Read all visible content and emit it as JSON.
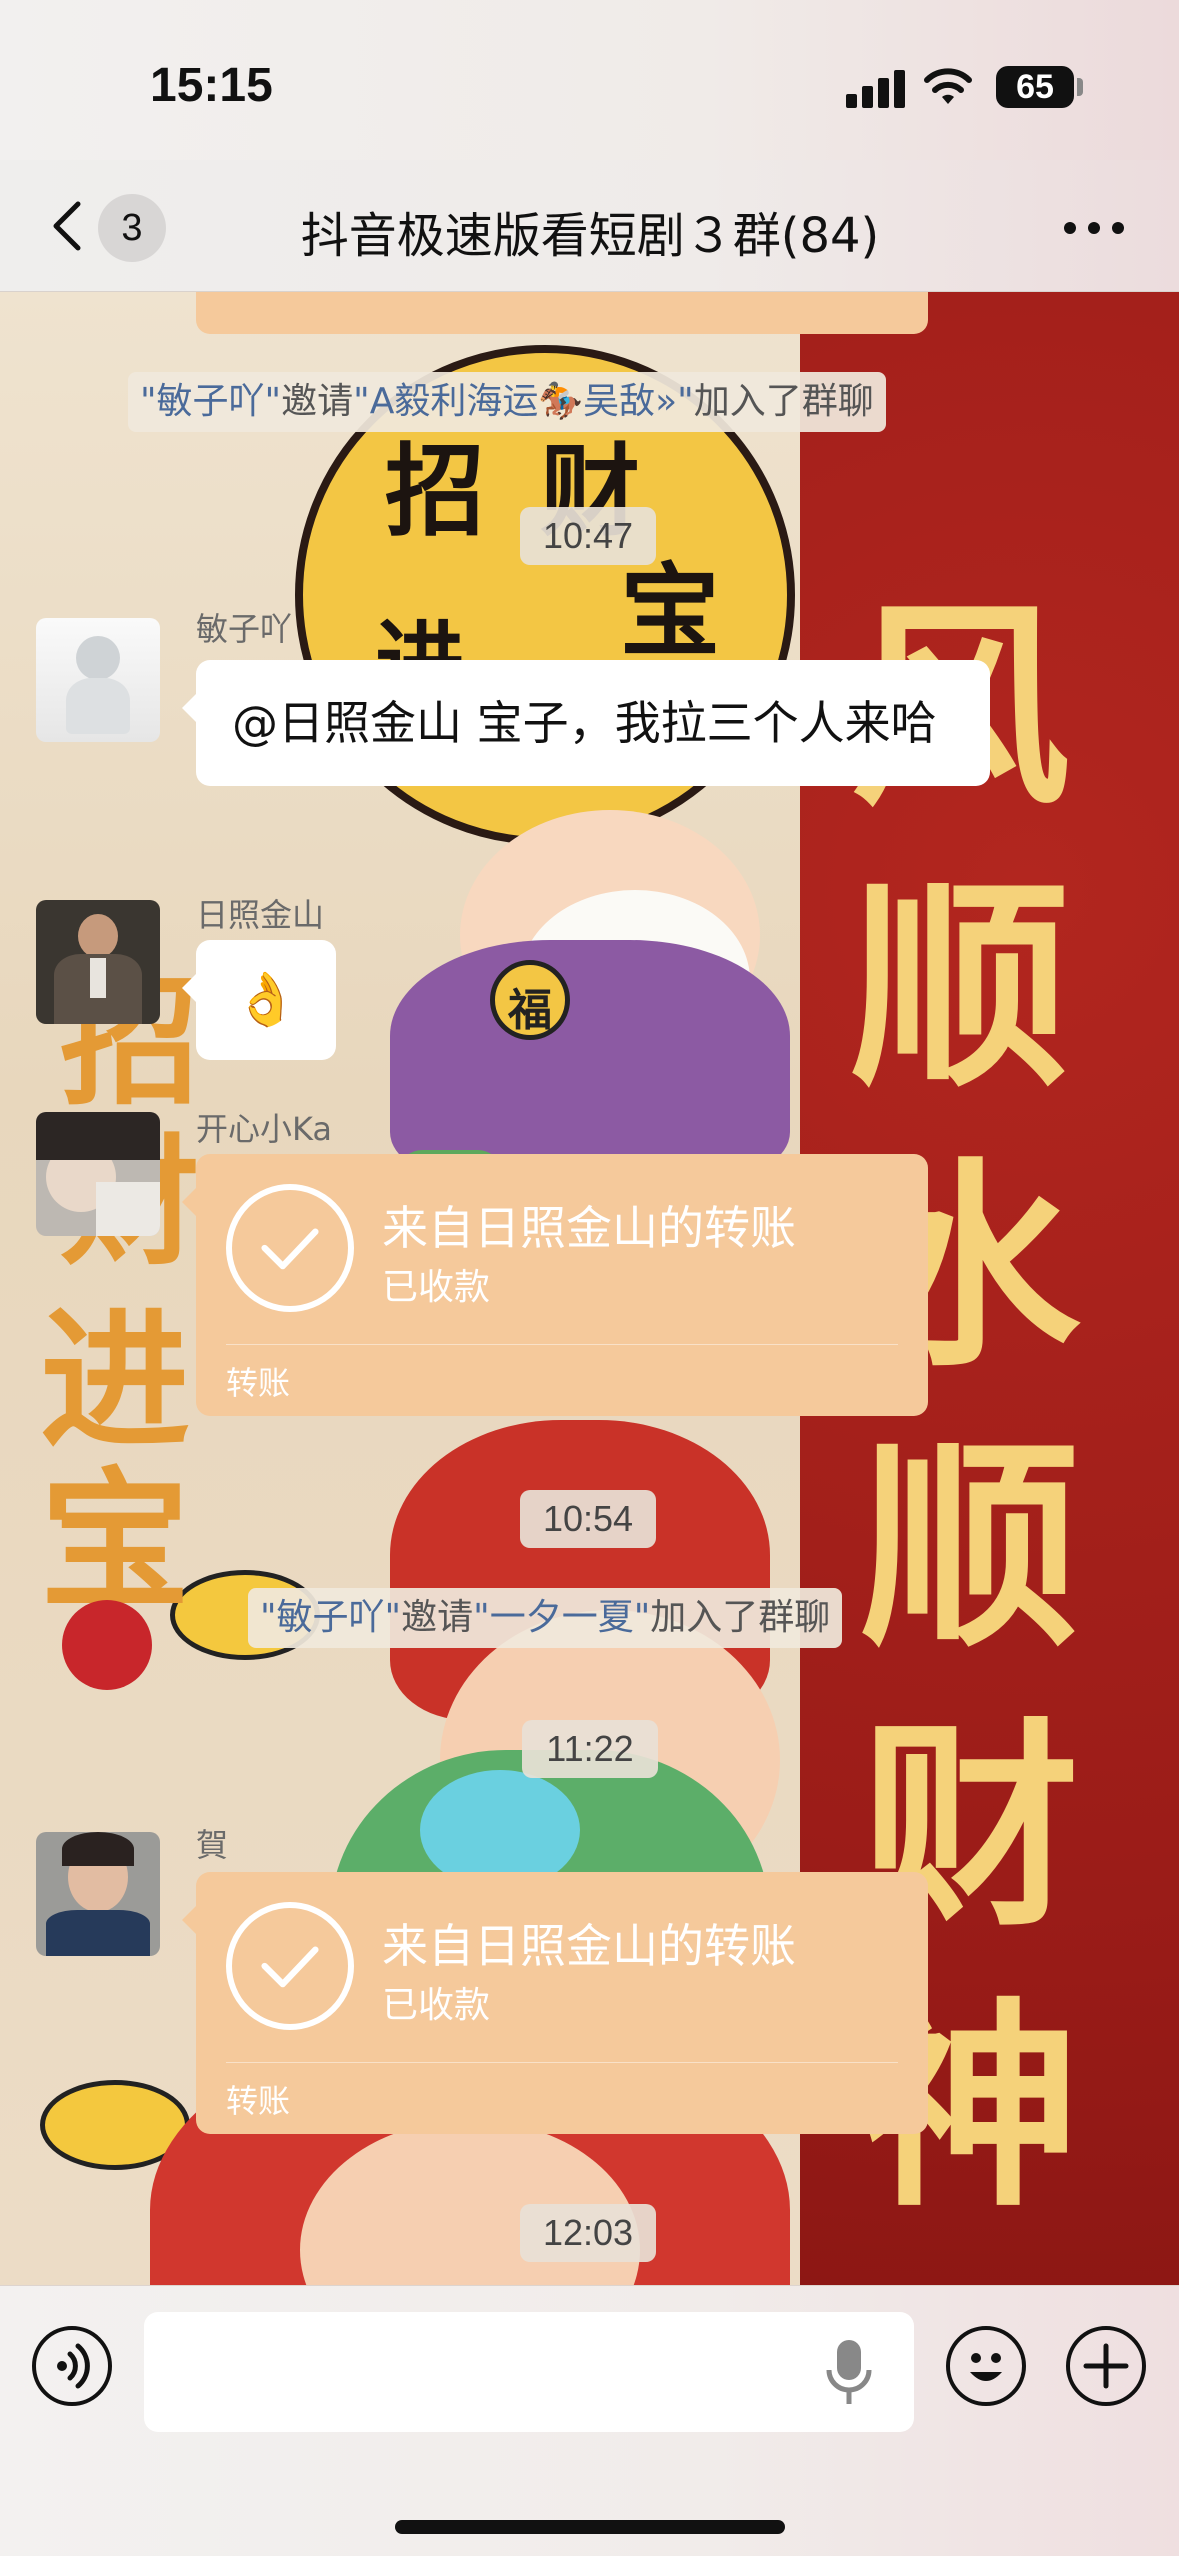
{
  "status_bar": {
    "time": "15:15",
    "battery": "65"
  },
  "nav": {
    "back_count": "3",
    "title": "抖音极速版看短剧３群(84)"
  },
  "messages": {
    "sys1": {
      "inviter": "\"敏子吖\"",
      "verb": "邀请",
      "invitee": "\"A毅利海运🏇吴敌»\"",
      "suffix": "加入了群聊"
    },
    "time1": "10:47",
    "msg1": {
      "sender": "敏子吖",
      "text": "@日照金山 宝子，我拉三个人来哈"
    },
    "msg2": {
      "sender": "日照金山",
      "emoji": "👌"
    },
    "msg3": {
      "sender": "开心小Ka",
      "title": "来自日照金山的转账",
      "status": "已收款",
      "label": "转账"
    },
    "time2": "10:54",
    "sys2": {
      "inviter": "\"敏子吖\"",
      "verb": "邀请",
      "invitee": "\"一夕一夏\"",
      "suffix": "加入了群聊"
    },
    "time3": "11:22",
    "msg4": {
      "sender": "賀",
      "title": "来自日照金山的转账",
      "status": "已收款",
      "label": "转账"
    },
    "time4": "12:03"
  },
  "background": {
    "left_chars": [
      "招",
      "财",
      "进",
      "宝"
    ],
    "coin_chars": [
      "招",
      "财",
      "进",
      "宝"
    ],
    "hat_char": "福",
    "right_chars": [
      "风",
      "顺",
      "水",
      "顺",
      "财",
      "神"
    ]
  },
  "input": {
    "placeholder": ""
  },
  "icons": {
    "back": "chevron-left-icon",
    "more": "more-dots-icon",
    "voice": "voice-toggle-icon",
    "mic": "microphone-icon",
    "emoji": "emoji-icon",
    "plus": "plus-icon",
    "check": "check-icon"
  }
}
